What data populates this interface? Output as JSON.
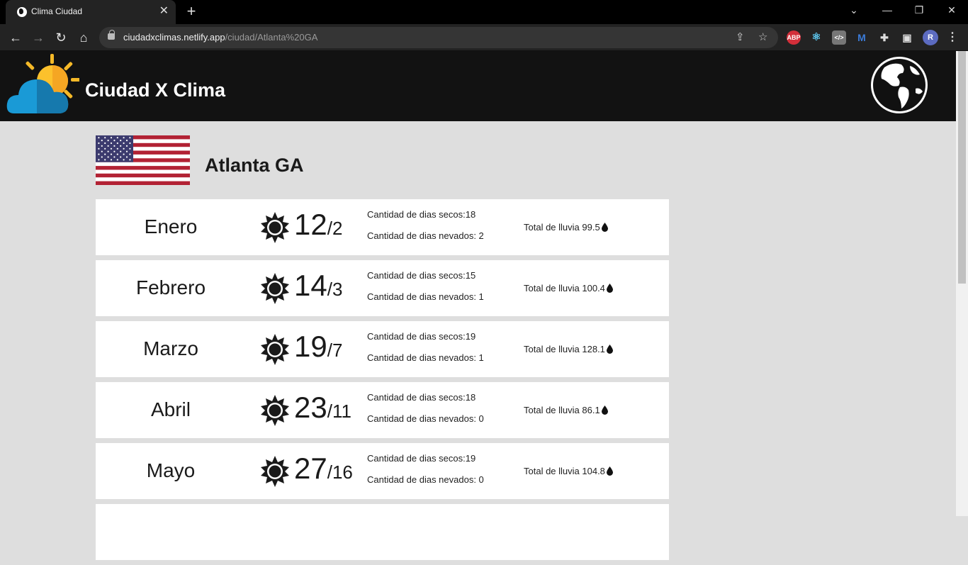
{
  "browser": {
    "tab_title": "Clima Ciudad",
    "tab_close": "✕",
    "new_tab": "+",
    "url_host": "ciudadxclimas.netlify.app",
    "url_path": "/ciudad/Atlanta%20GA",
    "profile_initial": "R",
    "ext_abp": "ABP",
    "ext_code": "</>"
  },
  "site": {
    "title": "Ciudad X Clima"
  },
  "city": {
    "name": "Atlanta GA",
    "flag_icon": "us-flag-icon"
  },
  "months": [
    {
      "name": "Enero",
      "max": "12",
      "min": "2",
      "dry": "Cantidad de dias secos:18",
      "snow": "Cantidad de dias nevados: 2",
      "rain": "Total de lluvia 99.5"
    },
    {
      "name": "Febrero",
      "max": "14",
      "min": "3",
      "dry": "Cantidad de dias secos:15",
      "snow": "Cantidad de dias nevados: 1",
      "rain": "Total de lluvia 100.4"
    },
    {
      "name": "Marzo",
      "max": "19",
      "min": "7",
      "dry": "Cantidad de dias secos:19",
      "snow": "Cantidad de dias nevados: 1",
      "rain": "Total de lluvia 128.1"
    },
    {
      "name": "Abril",
      "max": "23",
      "min": "11",
      "dry": "Cantidad de dias secos:18",
      "snow": "Cantidad de dias nevados: 0",
      "rain": "Total de lluvia 86.1"
    },
    {
      "name": "Mayo",
      "max": "27",
      "min": "16",
      "dry": "Cantidad de dias secos:19",
      "snow": "Cantidad de dias nevados: 0",
      "rain": "Total de lluvia 104.8"
    }
  ],
  "colors": {
    "header_bg": "#121212",
    "page_bg": "#dedede",
    "card_bg": "#ffffff"
  }
}
